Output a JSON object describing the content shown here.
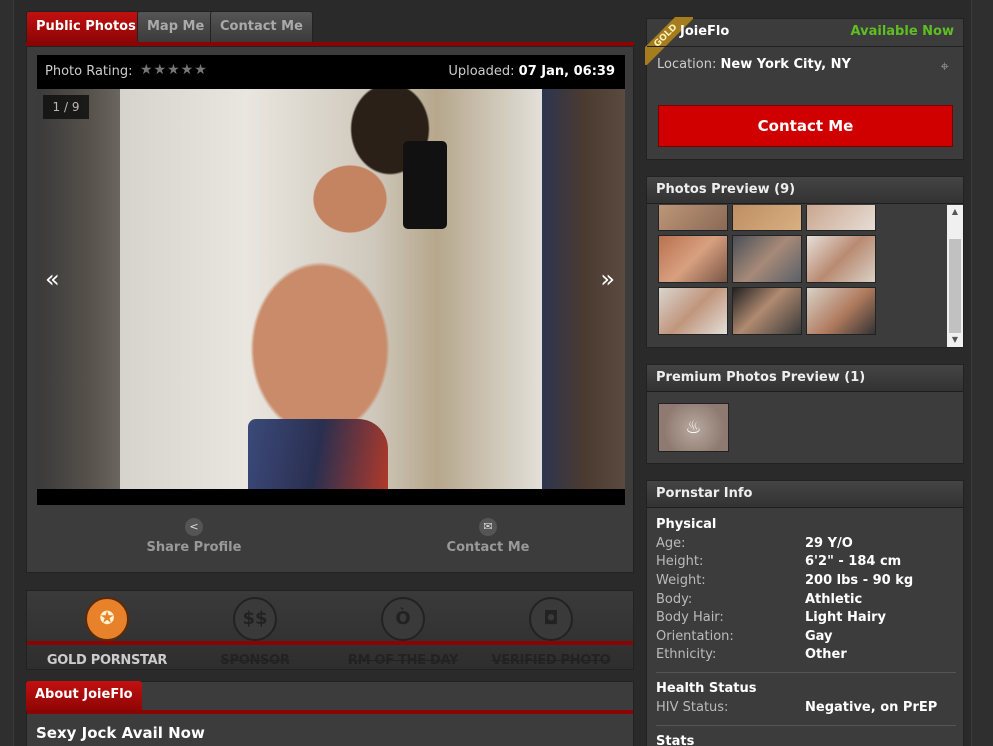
{
  "tabs": [
    "Public Photos",
    "Map Me",
    "Contact Me"
  ],
  "photo": {
    "rating_label": "Photo Rating:",
    "rating_stars": "★★★★★",
    "uploaded_label": "Uploaded:",
    "uploaded_value": "07 Jan, 06:39",
    "counter": "1 / 9",
    "prev_arrow": "«",
    "next_arrow": "»"
  },
  "actions": {
    "share_label": "Share Profile",
    "contact_label": "Contact Me"
  },
  "awards": [
    {
      "label": "GOLD PORNSTAR",
      "active": true,
      "icon": "medal-icon",
      "glyph": "✪"
    },
    {
      "label": "SPONSOR",
      "active": false,
      "icon": "dollar-icon",
      "glyph": "$$"
    },
    {
      "label": "RM OF THE DAY",
      "active": false,
      "icon": "devil-icon",
      "glyph": "Ò"
    },
    {
      "label": "VERIFIED PHOTO",
      "active": false,
      "icon": "camera-icon",
      "glyph": "◘"
    }
  ],
  "about": {
    "tab": "About JoieFlo",
    "headline": "Sexy Jock Avail Now"
  },
  "profile": {
    "badge": "GOLD",
    "username": "JoieFlo",
    "status": "Available Now",
    "location_label": "Location:",
    "location_value": "New York City, NY",
    "contact_button": "Contact Me"
  },
  "photos_preview": {
    "title": "Photos Preview (9)"
  },
  "premium_preview": {
    "title": "Premium Photos Preview (1)"
  },
  "pornstar_info": {
    "title": "Pornstar Info",
    "physical_title": "Physical",
    "physical": [
      {
        "label": "Age:",
        "value": "29 Y/O"
      },
      {
        "label": "Height:",
        "value": "6'2\" - 184 cm"
      },
      {
        "label": "Weight:",
        "value": "200 lbs - 90 kg"
      },
      {
        "label": "Body:",
        "value": "Athletic"
      },
      {
        "label": "Body Hair:",
        "value": "Light Hairy"
      },
      {
        "label": "Orientation:",
        "value": "Gay"
      },
      {
        "label": "Ethnicity:",
        "value": "Other"
      }
    ],
    "health_title": "Health Status",
    "health": [
      {
        "label": "HIV Status:",
        "value": "Negative, on PrEP"
      }
    ],
    "stats_title": "Stats"
  },
  "colors": {
    "accent_red": "#d10000",
    "available_green": "#5fbe24",
    "gold": "#a57d1e",
    "award_active": "#e8822a"
  }
}
